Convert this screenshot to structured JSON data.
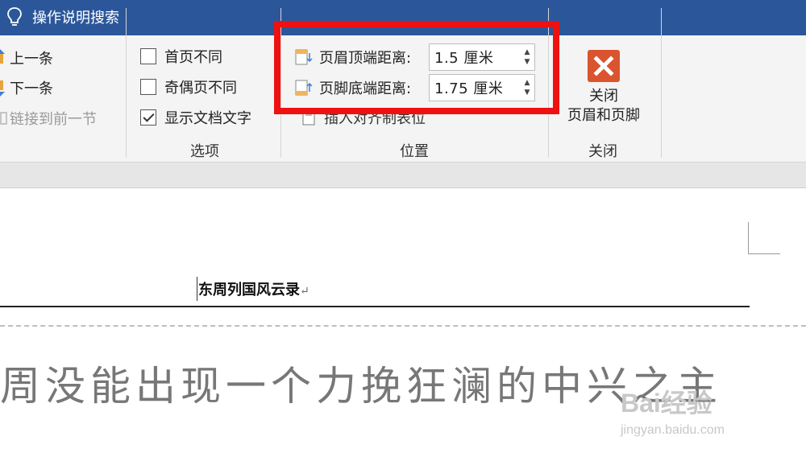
{
  "titlebar": {
    "tell_me": "操作说明搜索"
  },
  "navigation": {
    "items": [
      {
        "label": "上一条",
        "enabled": true
      },
      {
        "label": "下一条",
        "enabled": true
      },
      {
        "label": "链接到前一节",
        "enabled": false
      }
    ]
  },
  "options": {
    "group_label": "选项",
    "checkboxes": [
      {
        "label": "首页不同",
        "checked": false
      },
      {
        "label": "奇偶页不同",
        "checked": false
      },
      {
        "label": "显示文档文字",
        "checked": true
      }
    ]
  },
  "position": {
    "group_label": "位置",
    "header_top_label": "页眉顶端距离:",
    "header_top_value": "1.5 厘米",
    "footer_bottom_label": "页脚底端距离:",
    "footer_bottom_value": "1.75 厘米",
    "insert_alignment_tab": "插入对齐制表位"
  },
  "close": {
    "group_label": "关闭",
    "button_line1": "关闭",
    "button_line2": "页眉和页脚"
  },
  "document": {
    "header_text": "东周列国风云录",
    "body_text": "周没能出现一个力挽狂澜的中兴之主"
  },
  "watermark": {
    "brand": "Bai经验",
    "url": "jingyan.baidu.com"
  },
  "colors": {
    "titlebar": "#2b579a",
    "highlight": "#ee1111",
    "close_icon": "#d9542f"
  }
}
